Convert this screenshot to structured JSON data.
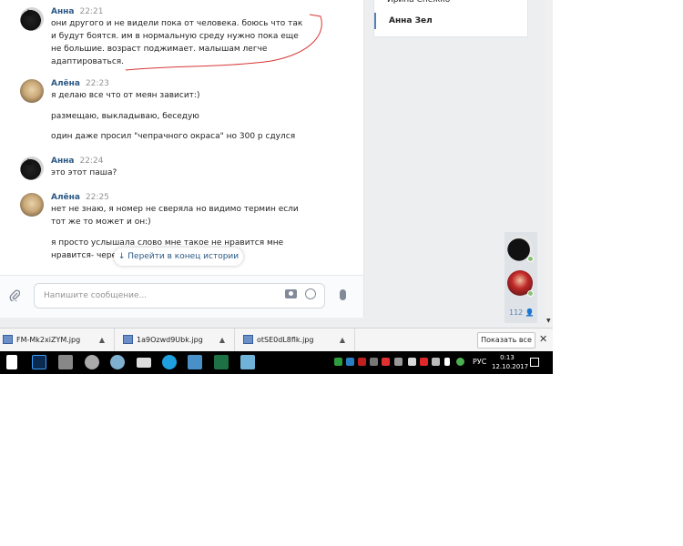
{
  "sidebar": {
    "items": [
      {
        "label": "Ирина Снежко",
        "active": false
      },
      {
        "label": "Анна Зел",
        "active": true
      }
    ]
  },
  "messages": [
    {
      "author": "Анна",
      "time": "22:21",
      "avatar": "black-cat",
      "lines": [
        "они другого и не видели пока от человека. боюсь что так и будут боятся. им в нормальную среду нужно пока еще не большие. возраст поджимает. малышам легче адаптироваться."
      ]
    },
    {
      "author": "Алёна",
      "time": "22:23",
      "avatar": "dog",
      "lines": [
        "я делаю все что от меян зависит:)",
        "размещаю, выкладываю, беседую",
        "один даже просил \"чепрачного окраса\" но 300 р сдулся"
      ]
    },
    {
      "author": "Анна",
      "time": "22:24",
      "avatar": "black-cat",
      "lines": [
        "это этот паша?"
      ]
    },
    {
      "author": "Алёна",
      "time": "22:25",
      "avatar": "dog",
      "lines": [
        "нет не знаю, я номер не сверяла но видимо термин если тот же то может и он:)",
        "я просто услышала слово мне такое не нравится мне нравится- черепаховый окрас"
      ]
    }
  ],
  "jump_button": {
    "label": "Перейти в конец истории",
    "icon": "arrow-down-icon"
  },
  "composer": {
    "placeholder": "Напишите сообщение...",
    "icons": [
      "paperclip-icon",
      "camera-icon",
      "smile-icon",
      "microphone-icon"
    ]
  },
  "rail": {
    "count": "112"
  },
  "downloads": {
    "files": [
      "FM-Mk2xiZYM.jpg",
      "1a9Ozwd9Ubk.jpg",
      "otSE0dL8flk.jpg"
    ],
    "show_all": "Показать все"
  },
  "taskbar": {
    "lang": "РУС",
    "time": "0:13",
    "date": "12.10.2017",
    "colors": {
      "accent": "#5181b8",
      "name": "#2a5885"
    }
  }
}
